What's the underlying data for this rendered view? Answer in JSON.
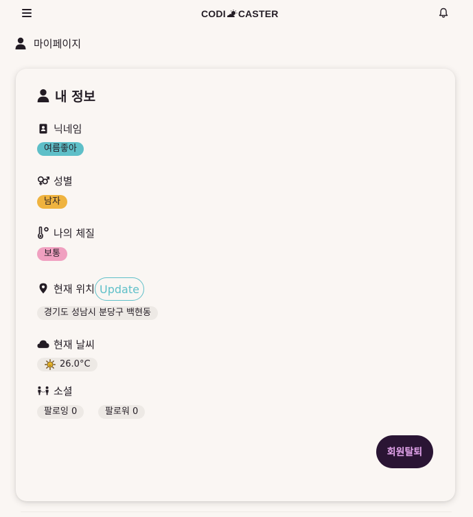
{
  "header": {
    "logo_left": "CODI",
    "logo_right": "CASTER",
    "menu_icon": "hamburger-menu-icon",
    "notification_icon": "bell-icon"
  },
  "breadcrumb": {
    "label": "마이페이지",
    "icon": "user-icon"
  },
  "card": {
    "title": "내 정보",
    "title_icon": "user-icon",
    "nickname": {
      "label": "닉네임",
      "icon": "contact-card-icon",
      "value": "여름좋아"
    },
    "gender": {
      "label": "성별",
      "icon": "gender-icon",
      "value": "남자"
    },
    "constitution": {
      "label": "나의 체질",
      "icon": "thermometer-icon",
      "value": "보통"
    },
    "location": {
      "label": "현재 위치",
      "icon": "map-pin-icon",
      "update_label": "Update",
      "value": "경기도 성남시 분당구 백현동"
    },
    "weather": {
      "label": "현재 날씨",
      "icon": "cloud-icon",
      "value": "26.0°C",
      "value_icon": "sun-icon"
    },
    "social": {
      "label": "소셜",
      "icon": "people-icon",
      "following": "팔로잉 0",
      "followers": "팔로워 0"
    },
    "withdraw_label": "회원탈퇴"
  },
  "colors": {
    "background": "#faf6f3",
    "text": "#231c24",
    "teal": "#5ebfc8",
    "orange": "#efb33f",
    "pink": "#f0a0c0",
    "chip_gray": "#ede9e5",
    "withdraw_bg": "#2a1534",
    "withdraw_text": "#e5a6ee"
  }
}
